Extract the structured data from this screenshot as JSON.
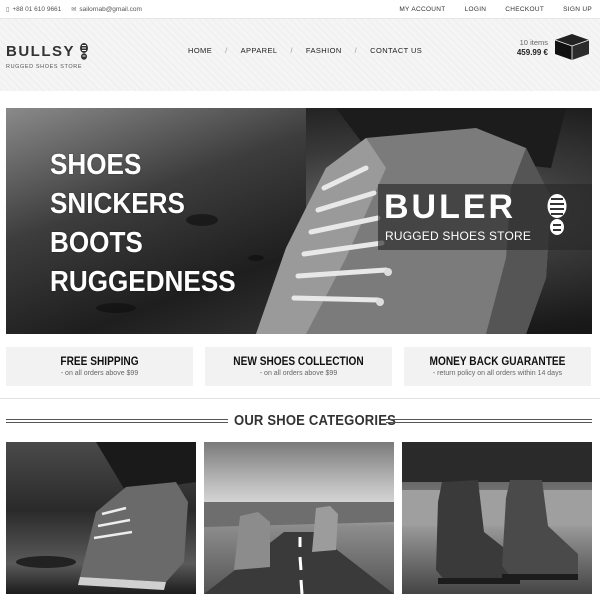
{
  "topbar": {
    "phone": "+88 01 610 9661",
    "email": "sailornab@gmail.com",
    "links": [
      "MY ACCOUNT",
      "LOGIN",
      "CHECKOUT",
      "SIGN UP"
    ]
  },
  "header": {
    "brand": "BULLSY",
    "tagline": "RUGGED SHOES STORE",
    "nav": [
      "HOME",
      "APPAREL",
      "FASHION",
      "CONTACT US"
    ],
    "cart": {
      "count": "10 items",
      "total": "459.99 €"
    }
  },
  "hero": {
    "lines": [
      "SHOES",
      "SNICKERS",
      "BOOTS",
      "RUGGEDNESS"
    ],
    "badge_name": "BULER",
    "badge_tagline": "RUGGED SHOES STORE"
  },
  "features": [
    {
      "title": "FREE SHIPPING",
      "subtitle": "- on all orders above $99"
    },
    {
      "title": "NEW SHOES COLLECTION",
      "subtitle": "- on all orders above $99"
    },
    {
      "title": "MONEY BACK GUARANTEE",
      "subtitle": "- return policy on all orders within 14 days"
    }
  ],
  "categories": {
    "title": "OUR SHOE CATEGORIES"
  },
  "icons": {
    "phone": "phone-icon",
    "email": "envelope-icon",
    "logo": "shoe-print-icon",
    "cart": "box-icon"
  },
  "colors": {
    "accent": "#333333",
    "panel": "#f2f2f2",
    "header_bg": "#f5f5f5"
  }
}
